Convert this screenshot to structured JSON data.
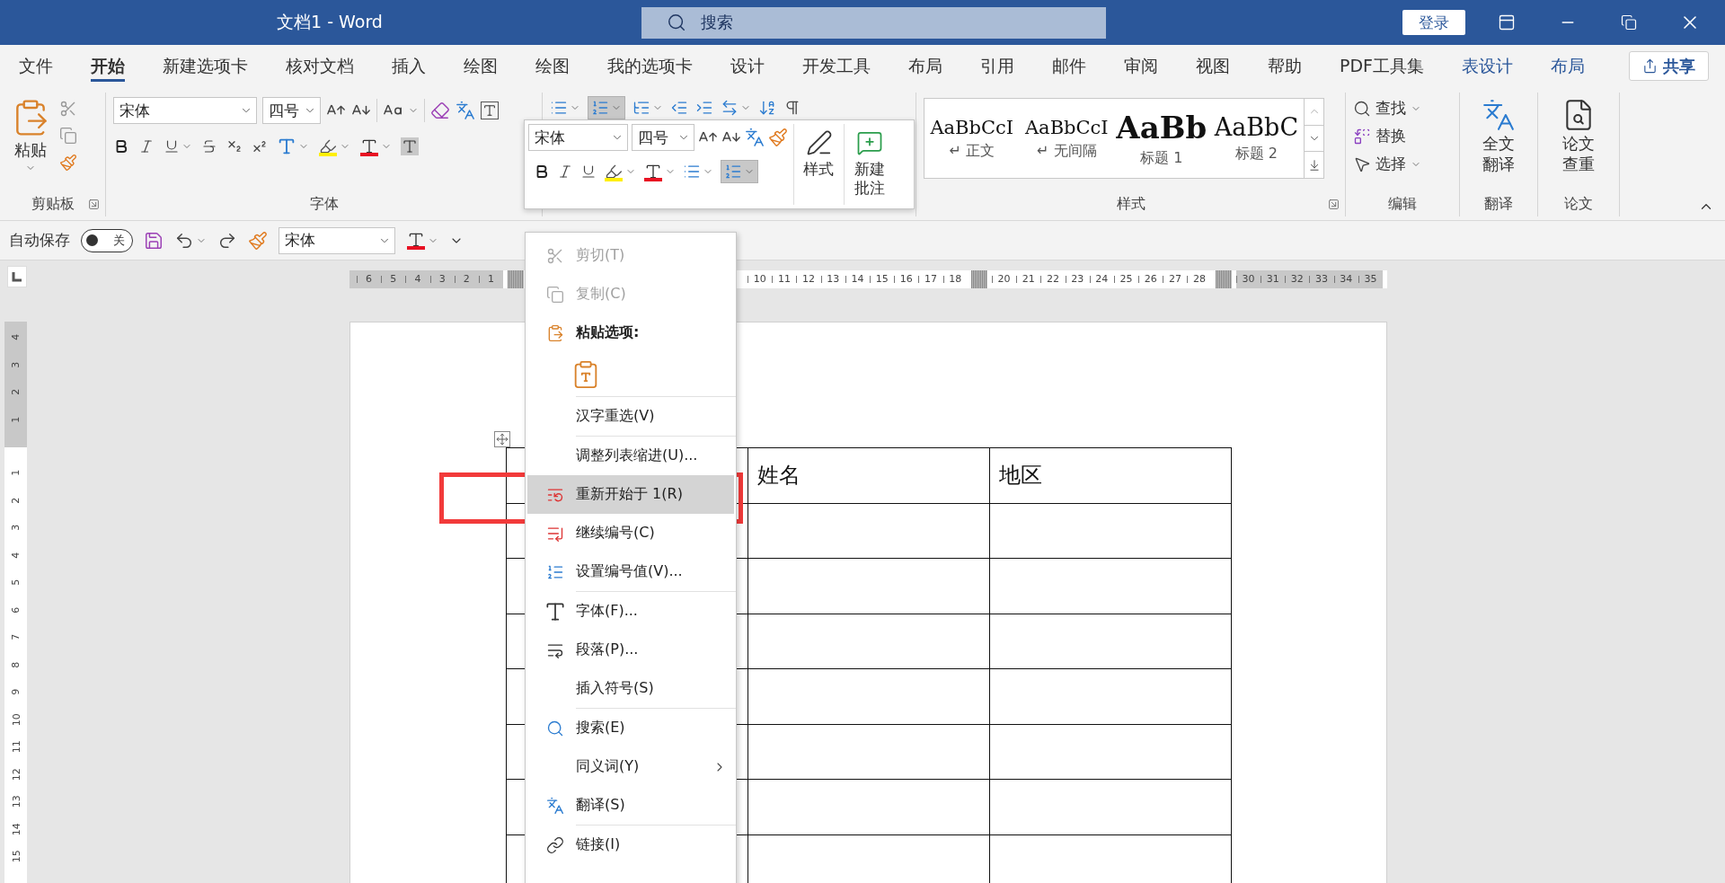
{
  "window": {
    "title": "文档1 - Word",
    "search_placeholder": "搜索",
    "sign_in": "登录"
  },
  "tabs": [
    {
      "label": "文件",
      "selected": false,
      "kind": "normal"
    },
    {
      "label": "开始",
      "selected": true,
      "kind": "normal"
    },
    {
      "label": "新建选项卡",
      "selected": false,
      "kind": "normal"
    },
    {
      "label": "核对文档",
      "selected": false,
      "kind": "normal"
    },
    {
      "label": "插入",
      "selected": false,
      "kind": "normal"
    },
    {
      "label": "绘图",
      "selected": false,
      "kind": "normal"
    },
    {
      "label": "绘图",
      "selected": false,
      "kind": "normal"
    },
    {
      "label": "我的选项卡",
      "selected": false,
      "kind": "normal"
    },
    {
      "label": "设计",
      "selected": false,
      "kind": "normal"
    },
    {
      "label": "开发工具",
      "selected": false,
      "kind": "normal"
    },
    {
      "label": "布局",
      "selected": false,
      "kind": "normal"
    },
    {
      "label": "引用",
      "selected": false,
      "kind": "normal"
    },
    {
      "label": "邮件",
      "selected": false,
      "kind": "normal"
    },
    {
      "label": "审阅",
      "selected": false,
      "kind": "normal"
    },
    {
      "label": "视图",
      "selected": false,
      "kind": "normal"
    },
    {
      "label": "帮助",
      "selected": false,
      "kind": "normal"
    },
    {
      "label": "PDF工具集",
      "selected": false,
      "kind": "normal"
    },
    {
      "label": "表设计",
      "selected": false,
      "kind": "contextual"
    },
    {
      "label": "布局",
      "selected": false,
      "kind": "contextual"
    }
  ],
  "share": "共享",
  "ribbon": {
    "clipboard": {
      "label": "剪贴板",
      "paste": "粘贴"
    },
    "font": {
      "label": "字体",
      "font": "宋体",
      "size": "四号"
    },
    "paragraph": {
      "numbering_selected": true
    },
    "styles": {
      "label": "样式",
      "items": [
        {
          "sample": "AaBbCcI",
          "name": "↵ 正文",
          "kind": "body"
        },
        {
          "sample": "AaBbCcI",
          "name": "↵ 无间隔",
          "kind": "body"
        },
        {
          "sample": "AaBb",
          "name": "标题 1",
          "kind": "heading1"
        },
        {
          "sample": "AaBbC",
          "name": "标题 2",
          "kind": "heading2"
        }
      ]
    },
    "editing": {
      "label": "编辑",
      "commands": [
        {
          "label": "查找",
          "dropdown": true
        },
        {
          "label": "替换",
          "dropdown": false
        },
        {
          "label": "选择",
          "dropdown": true
        }
      ]
    },
    "translate": {
      "label": "翻译",
      "button": "全文翻译"
    },
    "thesis": {
      "label": "论文",
      "button": "论文查重"
    }
  },
  "quick_access": {
    "autosave_label": "自动保存",
    "autosave_on": false,
    "autosave_state": "关",
    "font": "宋体"
  },
  "horizontal_ruler": {
    "segments": [
      {
        "kind": "margin",
        "labels": [
          "6",
          "5",
          "4",
          "3",
          "2",
          "1"
        ]
      },
      {
        "kind": "column",
        "labels": [
          "10",
          "11",
          "12",
          "13",
          "14",
          "15",
          "16",
          "17",
          "18"
        ]
      },
      {
        "kind": "column",
        "labels": [
          "20",
          "21",
          "22",
          "23",
          "24",
          "25",
          "26",
          "27",
          "28"
        ]
      },
      {
        "kind": "margin",
        "labels": [
          "30",
          "31",
          "32",
          "33",
          "34",
          "35"
        ]
      }
    ]
  },
  "vertical_ruler": {
    "segments": [
      {
        "kind": "margin",
        "labels": [
          "4",
          "3",
          "2",
          "1"
        ]
      },
      {
        "kind": "text",
        "labels": [
          "1",
          "2",
          "3",
          "4",
          "5",
          "6",
          "7",
          "8",
          "9",
          "10",
          "11",
          "12",
          "13",
          "14",
          "15"
        ]
      }
    ]
  },
  "table": {
    "heading": [
      "姓名",
      "地区"
    ]
  },
  "mini_toolbar": {
    "font": "宋体",
    "size": "四号",
    "numbering_selected": true,
    "buttons": [
      "样式",
      "新建批注"
    ]
  },
  "context_menu": {
    "groups": [
      [
        {
          "kind": "command",
          "label": "剪切(T)",
          "disabled": true,
          "selected": false,
          "submenu": false
        },
        {
          "kind": "command",
          "label": "复制(C)",
          "disabled": true,
          "selected": false,
          "submenu": false
        },
        {
          "kind": "heading",
          "label": "粘贴选项:",
          "disabled": false,
          "selected": false,
          "submenu": false
        },
        {
          "kind": "paste-options",
          "disabled": false,
          "selected": false,
          "submenu": false
        }
      ],
      [
        {
          "kind": "command",
          "label": "汉字重选(V)",
          "disabled": false,
          "selected": false,
          "submenu": false
        }
      ],
      [
        {
          "kind": "command",
          "label": "调整列表缩进(U)...",
          "disabled": false,
          "selected": false,
          "submenu": false
        },
        {
          "kind": "command",
          "label": "重新开始于 1(R)",
          "disabled": false,
          "selected": true,
          "submenu": false
        },
        {
          "kind": "command",
          "label": "继续编号(C)",
          "disabled": false,
          "selected": false,
          "submenu": false
        },
        {
          "kind": "command",
          "label": "设置编号值(V)...",
          "disabled": false,
          "selected": false,
          "submenu": false
        }
      ],
      [
        {
          "kind": "command",
          "label": "字体(F)...",
          "disabled": false,
          "selected": false,
          "submenu": false
        },
        {
          "kind": "command",
          "label": "段落(P)...",
          "disabled": false,
          "selected": false,
          "submenu": false
        },
        {
          "kind": "command",
          "label": "插入符号(S)",
          "disabled": false,
          "selected": false,
          "submenu": false
        }
      ],
      [
        {
          "kind": "command",
          "label": "搜索(E)",
          "disabled": false,
          "selected": false,
          "submenu": false
        },
        {
          "kind": "command",
          "label": "同义词(Y)",
          "disabled": false,
          "selected": false,
          "submenu": true
        },
        {
          "kind": "command",
          "label": "翻译(S)",
          "disabled": false,
          "selected": false,
          "submenu": false
        }
      ],
      [
        {
          "kind": "command",
          "label": "链接(I)",
          "disabled": false,
          "selected": false,
          "submenu": false
        }
      ]
    ]
  },
  "highlight_frame": true
}
